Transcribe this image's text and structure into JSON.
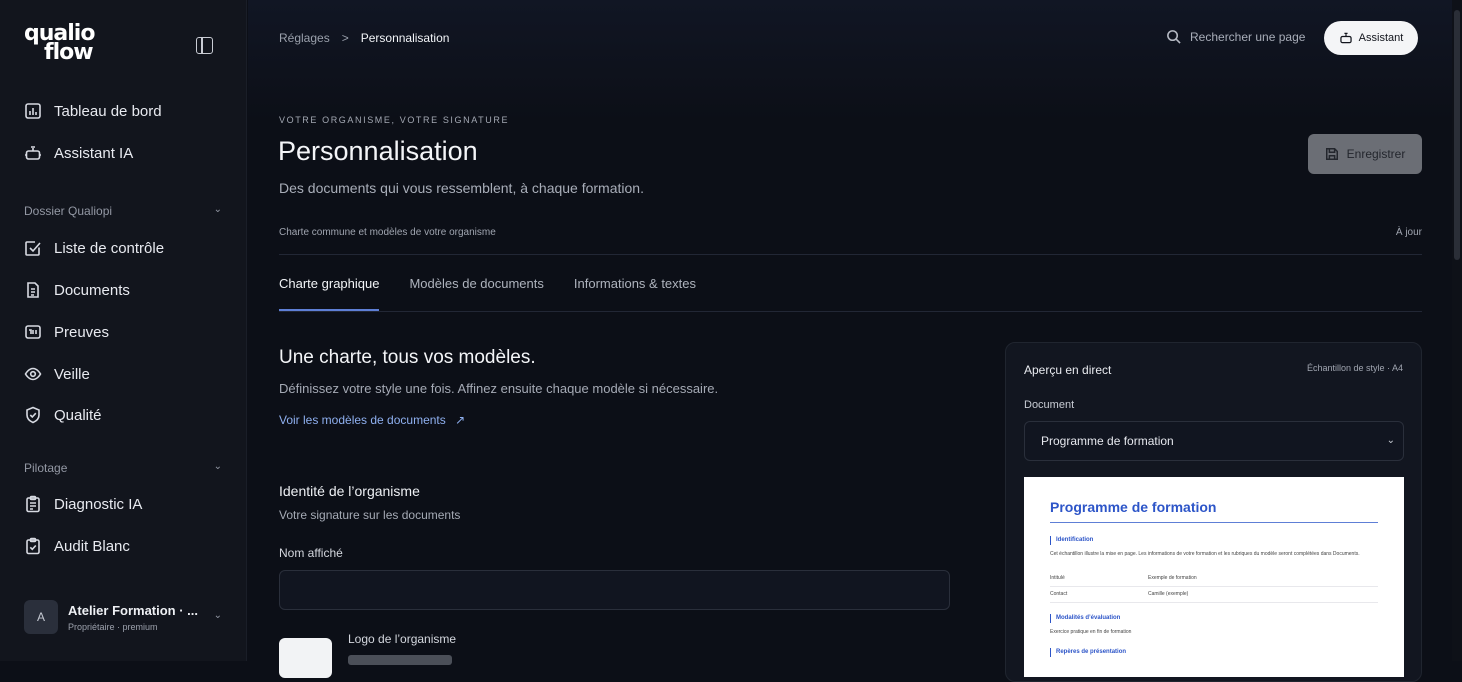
{
  "brand": {
    "line1": "qualio",
    "line2": "flow"
  },
  "sidebar": {
    "top_items": [
      {
        "label": "Tableau de bord"
      },
      {
        "label": "Assistant IA"
      }
    ],
    "sections": [
      {
        "title": "Dossier Qualiopi",
        "items": [
          {
            "label": "Liste de contrôle"
          },
          {
            "label": "Documents"
          },
          {
            "label": "Preuves"
          },
          {
            "label": "Veille"
          },
          {
            "label": "Qualité"
          }
        ]
      },
      {
        "title": "Pilotage",
        "items": [
          {
            "label": "Diagnostic IA"
          },
          {
            "label": "Audit Blanc"
          }
        ]
      }
    ],
    "user": {
      "initial": "A",
      "name": "Atelier Formation · ...",
      "role": "Propriétaire · premium"
    }
  },
  "header": {
    "breadcrumb": [
      "Réglages",
      "Personnalisation"
    ],
    "breadcrumb_sep": ">",
    "search_label": "Rechercher une page",
    "assistant_label": "Assistant"
  },
  "page": {
    "eyebrow": "VOTRE ORGANISME, VOTRE SIGNATURE",
    "title": "Personnalisation",
    "subtitle": "Des documents qui vous ressemblent, à chaque formation.",
    "save_label": "Enregistrer",
    "meta": "Charte commune et modèles de votre organisme",
    "status": "À jour",
    "tabs": [
      {
        "label": "Charte graphique",
        "active": true
      },
      {
        "label": "Modèles de documents",
        "active": false
      },
      {
        "label": "Informations & textes",
        "active": false
      }
    ]
  },
  "content": {
    "heading": "Une charte, tous vos modèles.",
    "subheading": "Définissez votre style une fois. Affinez ensuite chaque modèle si nécessaire.",
    "link_label": "Voir les modèles de documents",
    "link_arrow": "↗",
    "identity_title": "Identité de l’organisme",
    "identity_sub": "Votre signature sur les documents",
    "name_label": "Nom affiché",
    "name_value": "",
    "logo_label": "Logo de l’organisme"
  },
  "preview": {
    "title": "Aperçu en direct",
    "badge": "Échantillon de style · A4",
    "doc_label": "Document",
    "doc_selected": "Programme de formation",
    "paper": {
      "title": "Programme de formation",
      "s1": "Identification",
      "p1": "Cet échantillon illustre la mise en page. Les informations de votre formation et les rubriques du modèle seront complétées dans Documents.",
      "rows": [
        {
          "k": "Intitulé",
          "v": "Exemple de formation"
        },
        {
          "k": "Contact",
          "v": "Camille (exemple)"
        }
      ],
      "s2": "Modalités d’évaluation",
      "p2": "Exercice pratique en fin de formation",
      "s3": "Repères de présentation"
    }
  },
  "colors": {
    "accent": "#5e7fd6",
    "doc_blue": "#2d55c8",
    "background": "#0c0f17"
  }
}
